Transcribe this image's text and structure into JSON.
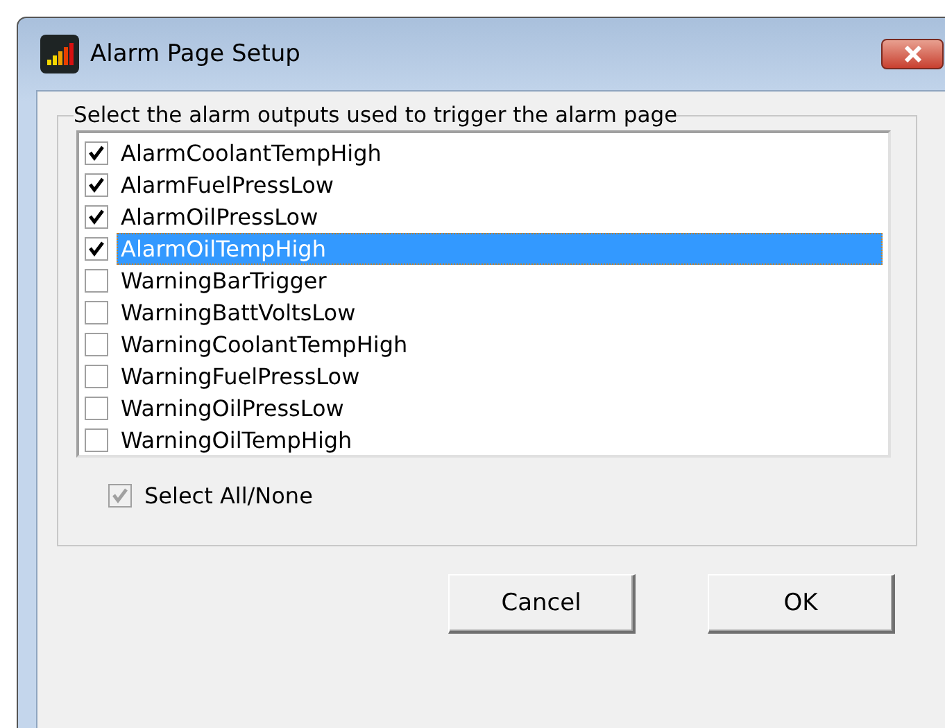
{
  "window": {
    "title": "Alarm Page Setup"
  },
  "group": {
    "label": "Select the alarm outputs used to trigger the alarm page"
  },
  "items": [
    {
      "label": "AlarmCoolantTempHigh",
      "checked": true,
      "selected": false
    },
    {
      "label": "AlarmFuelPressLow",
      "checked": true,
      "selected": false
    },
    {
      "label": "AlarmOilPressLow",
      "checked": true,
      "selected": false
    },
    {
      "label": "AlarmOilTempHigh",
      "checked": true,
      "selected": true
    },
    {
      "label": "WarningBarTrigger",
      "checked": false,
      "selected": false
    },
    {
      "label": "WarningBattVoltsLow",
      "checked": false,
      "selected": false
    },
    {
      "label": "WarningCoolantTempHigh",
      "checked": false,
      "selected": false
    },
    {
      "label": "WarningFuelPressLow",
      "checked": false,
      "selected": false
    },
    {
      "label": "WarningOilPressLow",
      "checked": false,
      "selected": false
    },
    {
      "label": "WarningOilTempHigh",
      "checked": false,
      "selected": false
    }
  ],
  "select_all": {
    "label": "Select All/None",
    "checked": true,
    "disabled": true
  },
  "buttons": [
    "Cancel",
    "OK"
  ]
}
